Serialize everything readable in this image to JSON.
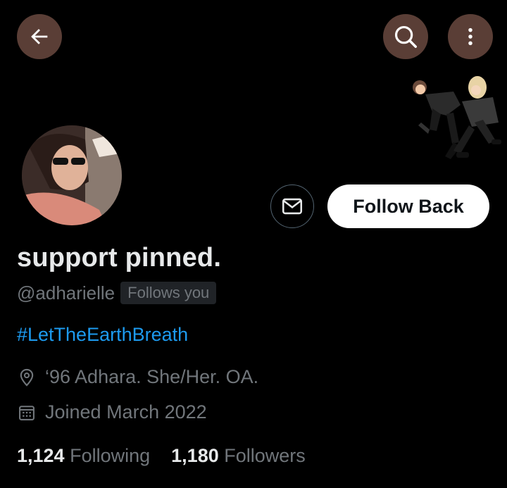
{
  "header": {
    "back_icon": "arrow-left-icon",
    "search_icon": "search-icon",
    "more_icon": "more-vertical-icon"
  },
  "profile": {
    "display_name": "support pinned.",
    "handle": "@adharielle",
    "follows_you_badge": "Follows you",
    "bio_hashtag": "#LetTheEarthBreath",
    "location": "‘96 Adhara. She/Her. OA.",
    "joined": "Joined March 2022"
  },
  "actions": {
    "message_icon": "envelope-icon",
    "follow_label": "Follow Back"
  },
  "stats": {
    "following_count": "1,124",
    "following_label": "Following",
    "followers_count": "1,180",
    "followers_label": "Followers"
  },
  "colors": {
    "background": "#000000",
    "link": "#1d9bf0",
    "secondary_text": "#71767b",
    "header_button": "#5a3e36"
  }
}
